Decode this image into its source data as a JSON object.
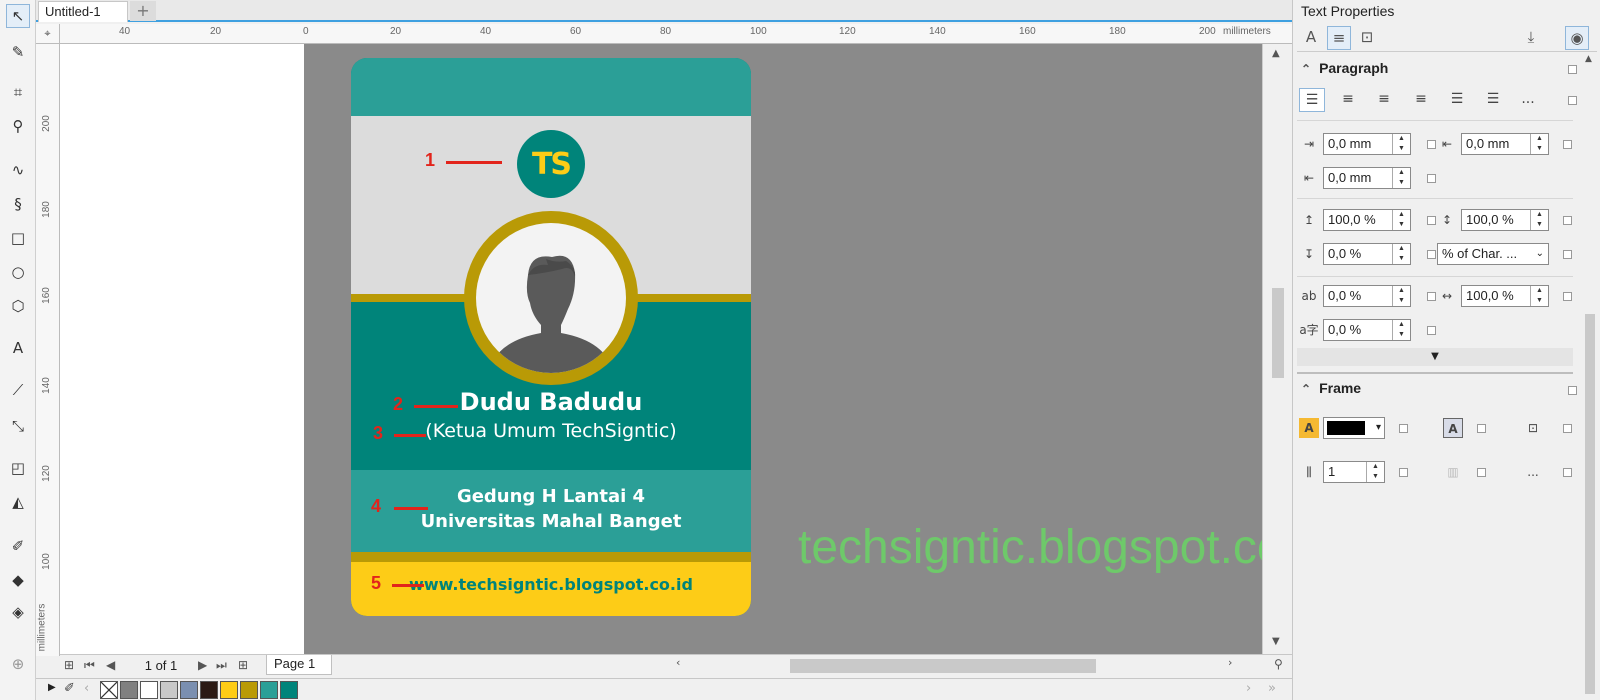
{
  "document": {
    "tab_title": "Untitled-1",
    "add_tab": "+"
  },
  "ruler": {
    "units": "millimeters",
    "h_ticks": [
      "40",
      "20",
      "0",
      "20",
      "40",
      "60",
      "80",
      "100",
      "120",
      "140",
      "160",
      "180",
      "200"
    ],
    "v_ticks": [
      "200",
      "180",
      "160",
      "140",
      "120",
      "100"
    ]
  },
  "card": {
    "logo_text": "TS",
    "name": "Dudu Badudu",
    "role": "(Ketua Umum TechSigntic)",
    "address_line1": "Gedung H Lantai 4",
    "address_line2": "Universitas Mahal Banget",
    "website": "www.techsigntic.blogspot.co.id",
    "markers": [
      "1",
      "2",
      "3",
      "4",
      "5"
    ],
    "colors": {
      "teal": "#00847a",
      "teal_light": "#2b9f97",
      "gold": "#b99a06",
      "yellow": "#fdcc17",
      "grey": "#dcdcdc"
    }
  },
  "watermark": "techsigntic.blogspot.co.id",
  "page_nav": {
    "count": "1 of 1",
    "page_tab": "Page 1"
  },
  "palette": [
    "#ffffff",
    "#808080",
    "#ffffff",
    "#c8c8c8",
    "#7a8fb0",
    "#2a1a14",
    "#fdcc17",
    "#b99a06",
    "#2b9f97",
    "#00847a"
  ],
  "panel": {
    "title": "Text Properties",
    "paragraph": {
      "heading": "Paragraph",
      "indent_left": "0,0 mm",
      "indent_first": "0,0 mm",
      "indent_right": "0,0 mm",
      "before_para": "100,0 %",
      "line_spacing": "100,0 %",
      "after_para": "0,0 %",
      "spacing_unit": "% of Char. ...",
      "char_spacing": "0,0 %",
      "word_spacing": "100,0 %",
      "lang_spacing": "0,0 %",
      "more": "..."
    },
    "frame": {
      "heading": "Frame",
      "columns": "1",
      "more": "..."
    }
  }
}
